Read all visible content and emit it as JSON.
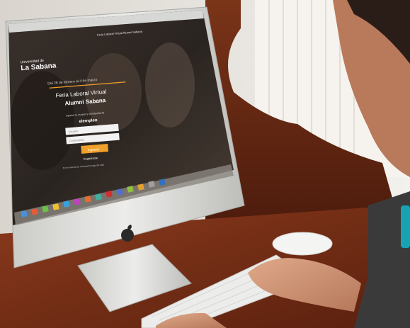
{
  "photo": {
    "description_role": "photograph of a person typing on an iMac displaying a university login page",
    "colors": {
      "wall": "#e9e6e1",
      "wood": "#6a2a16",
      "screen_bg": "#2d2622",
      "accent_orange": "#f0a12a",
      "monitor_silver": "#d8d8d6",
      "skin": "#c98a6d"
    }
  },
  "screen": {
    "top_nav": "Feria Laboral Virtual Alumni Sabana",
    "logo_line1": "Universidad de",
    "logo_line2": "La Sabana",
    "date_line": "Del 28 de febrero al 4 de marzo",
    "title_line1": "Feria Laboral Virtual",
    "title_line2": "Alumni Sabana",
    "register_prompt": "Ingrese su usuario y contraseña de",
    "brand_name": "elempleo",
    "username_placeholder": "Usuario",
    "password_placeholder": "Contraseña",
    "submit_label": "Ingresar",
    "signup_link": "Registrarse",
    "footer_text": "Si no recuerda su contraseña haga clic aquí"
  }
}
